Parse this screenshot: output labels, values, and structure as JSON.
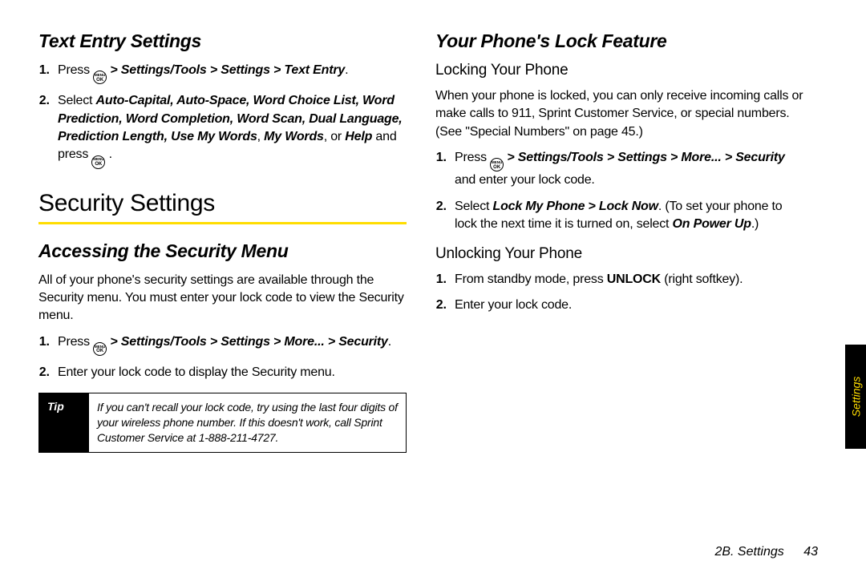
{
  "left": {
    "text_entry_heading": "Text Entry Settings",
    "te_step1_a": "Press ",
    "te_step1_path": " > Settings/Tools > Settings > Text Entry",
    "te_step1_end": ".",
    "te_step2_a": "Select ",
    "te_step2_opts": "Auto-Capital, Auto-Space, Word Choice List, Word Prediction, Word Completion, Word Scan, Dual Language, Prediction Length, Use My Words",
    "te_step2_b": ", ",
    "te_step2_my": "My Words",
    "te_step2_c": ", or ",
    "te_step2_help": "Help",
    "te_step2_d": " and press ",
    "te_step2_end": " .",
    "security_heading": "Security Settings",
    "access_heading": "Accessing the Security Menu",
    "access_body": "All of your phone's security settings are available through the Security menu. You must enter your lock code to view the Security menu.",
    "acc_step1_a": "Press ",
    "acc_step1_path": " > Settings/Tools > Settings > More... > Security",
    "acc_step1_end": ".",
    "acc_step2": "Enter your lock code to display the Security menu.",
    "tip_label": "Tip",
    "tip_body": "If you can't recall your lock code, try using the last four digits of your wireless phone number. If this doesn't work, call Sprint Customer Service at 1-888-211-4727."
  },
  "right": {
    "lock_heading": "Your Phone's Lock Feature",
    "locking_heading": "Locking Your Phone",
    "locking_body": "When your phone is locked, you can only receive incoming calls or make calls to 911, Sprint Customer Service, or special numbers. (See \"Special Numbers\" on page 45.)",
    "lk_step1_a": "Press ",
    "lk_step1_path": " > Settings/Tools > Settings > More... > Security",
    "lk_step1_b": " and enter your lock code.",
    "lk_step2_a": "Select ",
    "lk_step2_path": "Lock My Phone > Lock Now",
    "lk_step2_b": ". (To set your phone to lock the next time it is turned on, select ",
    "lk_step2_onpower": "On Power Up",
    "lk_step2_c": ".)",
    "unlocking_heading": "Unlocking Your Phone",
    "ul_step1_a": "From standby mode, press ",
    "ul_step1_unlock": "UNLOCK",
    "ul_step1_b": " (right softkey).",
    "ul_step2": "Enter your lock code."
  },
  "side_tab": "Settings",
  "footer_section": "2B. Settings",
  "footer_page": "43",
  "ok_top": "MENU",
  "ok_bot": "OK"
}
